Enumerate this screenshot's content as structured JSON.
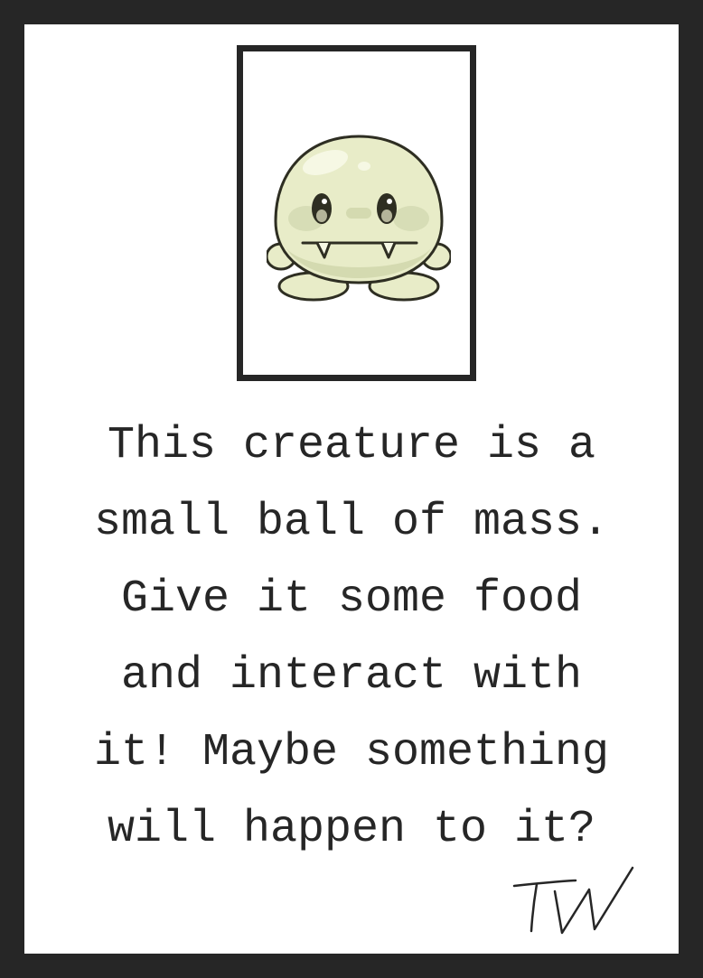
{
  "card": {
    "description_lines": [
      "This creature is a",
      "small ball of mass.",
      "Give it some food",
      "and interact with",
      "it! Maybe something",
      "will happen to it?"
    ],
    "signature": "TW"
  },
  "colors": {
    "frame": "#262626",
    "card": "#ffffff",
    "creature_body": "#e8ecc8",
    "creature_outline": "#2e2e22"
  },
  "icons": {
    "creature": "blob-creature-icon"
  }
}
